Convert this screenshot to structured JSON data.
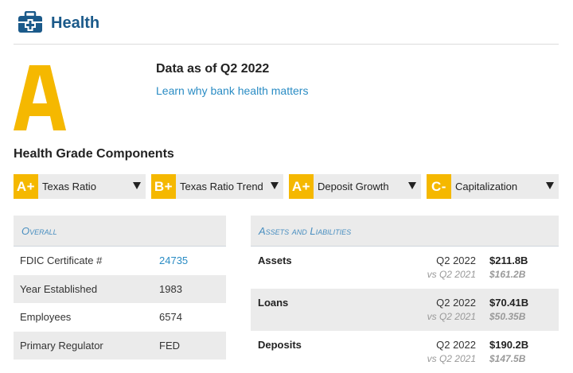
{
  "header": {
    "title": "Health",
    "icon": "medical-kit-icon"
  },
  "grade": {
    "letter": "A",
    "color": "#f5b800"
  },
  "data_as_of": "Data as of Q2 2022",
  "learn_link": "Learn why bank health matters",
  "components_title": "Health Grade Components",
  "components": [
    {
      "grade": "A+",
      "label": "Texas Ratio"
    },
    {
      "grade": "B+",
      "label": "Texas Ratio Trend"
    },
    {
      "grade": "A+",
      "label": "Deposit Growth"
    },
    {
      "grade": "C-",
      "label": "Capitalization"
    }
  ],
  "overall": {
    "heading": "Overall",
    "rows": [
      {
        "label": "FDIC Certificate #",
        "value": "24735"
      },
      {
        "label": "Year Established",
        "value": "1983"
      },
      {
        "label": "Employees",
        "value": "6574"
      },
      {
        "label": "Primary Regulator",
        "value": "FED"
      }
    ]
  },
  "assets_liabilities": {
    "heading": "Assets and Liabilities",
    "rows": [
      {
        "label": "Assets",
        "period": "Q2 2022",
        "value": "$211.8B",
        "prev_period": "vs Q2 2021",
        "prev_value": "$161.2B"
      },
      {
        "label": "Loans",
        "period": "Q2 2022",
        "value": "$70.41B",
        "prev_period": "vs Q2 2021",
        "prev_value": "$50.35B"
      },
      {
        "label": "Deposits",
        "period": "Q2 2022",
        "value": "$190.2B",
        "prev_period": "vs Q2 2021",
        "prev_value": "$147.5B"
      }
    ]
  }
}
